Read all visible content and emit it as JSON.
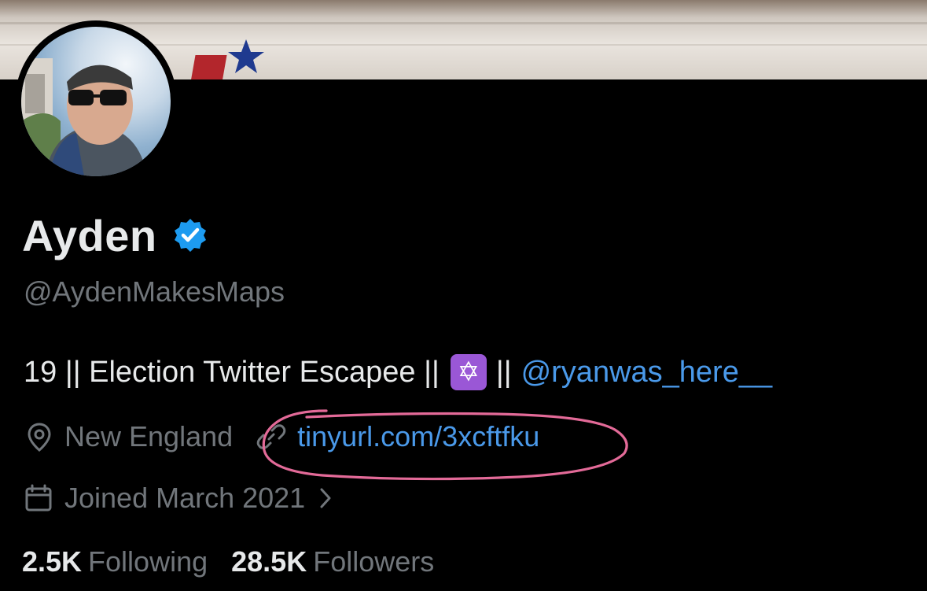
{
  "profile": {
    "display_name": "Ayden",
    "verified": true,
    "handle": "@AydenMakesMaps",
    "bio": {
      "text_before": "19 || Election Twitter Escapee ||",
      "emoji": "✡",
      "text_after": "||",
      "mention": "@ryanwas_here__"
    },
    "location": "New England",
    "website": "tinyurl.com/3xcftfku",
    "joined": "Joined March 2021",
    "stats": {
      "following_count": "2.5K",
      "following_label": "Following",
      "followers_count": "28.5K",
      "followers_label": "Followers"
    }
  },
  "colors": {
    "background": "#000000",
    "primary_text": "#e7e9ea",
    "secondary_text": "#71767b",
    "link": "#4a99e9",
    "verified_badge": "#1d9bf0",
    "annotation_circle": "#e36a98",
    "emoji_bg": "#9a57d6"
  },
  "icons": {
    "verified": "verified-badge-icon",
    "location": "location-pin-icon",
    "link": "link-icon",
    "calendar": "calendar-icon",
    "chevron": "chevron-right-icon"
  }
}
